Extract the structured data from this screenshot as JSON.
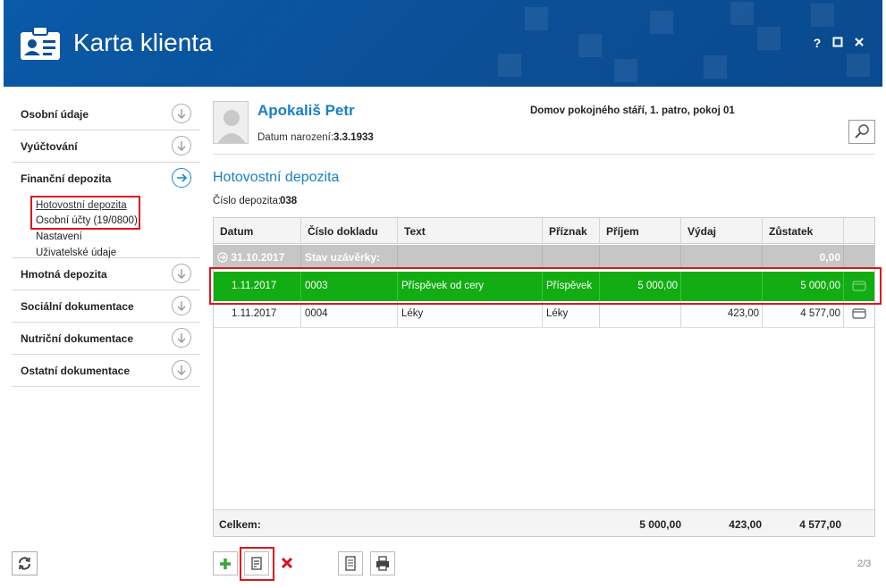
{
  "header": {
    "title": "Karta klienta",
    "help": "?",
    "maximize": "□",
    "close": "✕"
  },
  "sidebar": {
    "items_top": [
      {
        "label": "Osobní údaje"
      },
      {
        "label": "Vyúčtování"
      }
    ],
    "financni": {
      "label": "Finanční depozita",
      "subitems": [
        "Hotovostní depozita",
        "Osobní účty (19/0800)",
        "Nastavení",
        "Uživatelské údaje"
      ]
    },
    "items_bottom": [
      {
        "label": "Hmotná depozita"
      },
      {
        "label": "Sociální dokumentace"
      },
      {
        "label": "Nutriční dokumentace"
      },
      {
        "label": "Ostatní dokumentace"
      }
    ]
  },
  "client": {
    "name": "Apokališ Petr",
    "birth_label": "Datum narození:",
    "birth_date": "3.3.1933",
    "location": "Domov pokojného stáří, 1. patro, pokoj 01"
  },
  "section": {
    "title": "Hotovostní depozita",
    "deposit_label": "Číslo depozita:",
    "deposit_number": "038"
  },
  "table": {
    "columns": [
      "Datum",
      "Číslo dokladu",
      "Text",
      "Příznak",
      "Příjem",
      "Výdaj",
      "Zůstatek"
    ],
    "group_row": {
      "date": "31.10.2017",
      "label": "Stav uzávěrky:",
      "balance": "0,00"
    },
    "rows": [
      {
        "date": "1.11.2017",
        "doc": "0003",
        "text": "Příspěvek od cery",
        "flag": "Příspěvek",
        "income": "5 000,00",
        "expense": "",
        "balance": "5 000,00"
      },
      {
        "date": "1.11.2017",
        "doc": "0004",
        "text": "Léky",
        "flag": "Léky",
        "income": "",
        "expense": "423,00",
        "balance": "4 577,00"
      }
    ],
    "footer": {
      "label": "Celkem:",
      "income": "5 000,00",
      "expense": "423,00",
      "balance": "4 577,00"
    }
  },
  "toolbar": {
    "icons": [
      "add-icon",
      "edit-icon",
      "delete-icon",
      "document-icon",
      "print-icon"
    ]
  },
  "pager": {
    "text": "2/3"
  },
  "colors": {
    "header_bg": "#0b4f96",
    "accent": "#1a7fc7",
    "selected_row": "#12ad12",
    "highlight_border": "#e0141e"
  }
}
